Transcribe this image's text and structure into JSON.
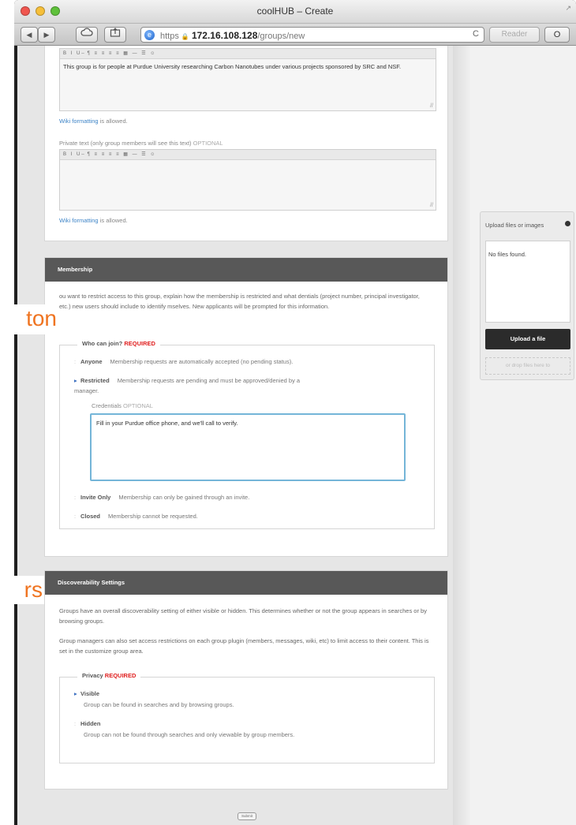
{
  "window": {
    "title": "coolHUB – Create",
    "back_glyph": "◀",
    "forward_glyph": "▶",
    "url_scheme": "https",
    "url_lock": "🔒",
    "url_host": "172.16.108.128",
    "url_path": "/groups/new",
    "reload_glyph": "C",
    "reader_label": "Reader",
    "reading_list_glyph": "O",
    "resize_glyph": "↗"
  },
  "description": {
    "toolbar_glyphs": "B I U ̶ ¶ ≡ ≡ ≡ ≡ ▦ — ☰ ☺",
    "public_text": "This group is for people at Purdue University researching Carbon Nanotubes under various projects sponsored by SRC and NSF.",
    "wiki_link": "Wiki formatting",
    "wiki_suffix": "is allowed.",
    "private_label": "Private text (only group members will see this text)",
    "private_optional": "OPTIONAL",
    "private_text": ""
  },
  "membership": {
    "header": "Membership",
    "intro": "ou want to restrict access to this group, explain how the membership is restricted and what dentials (project number, principal investigator, etc.) new users should include to identify mselves. New applicants will be prompted for this information.",
    "legend": "Who can join?",
    "required": "REQUIRED",
    "options": [
      {
        "name": "Anyone",
        "desc": "Membership requests are automatically accepted (no pending status).",
        "selected": false
      },
      {
        "name": "Restricted",
        "desc": "Membership requests are pending and must be approved/denied by a",
        "selected": true
      },
      {
        "name": "Invite Only",
        "desc": "Membership can only be gained through an invite.",
        "selected": false
      },
      {
        "name": "Closed",
        "desc": "Membership cannot be requested.",
        "selected": false
      }
    ],
    "restricted_cont": "manager.",
    "credentials_label": "Credentials",
    "credentials_optional": "OPTIONAL",
    "credentials_value": "Fill in your Purdue office phone, and we'll call to verify."
  },
  "discoverability": {
    "header": "Discoverability Settings",
    "para1": "Groups have an overall discoverability setting of either visible or hidden. This determines whether or not the group appears in searches or by browsing groups.",
    "para2": "Group managers can also set access restrictions on each group plugin (members, messages, wiki, etc) to limit access to their content. This is set in the customize group area.",
    "legend": "Privacy",
    "required": "REQUIRED",
    "options": [
      {
        "name": "Visible",
        "desc": "Group can be found in searches and by browsing groups.",
        "selected": true
      },
      {
        "name": "Hidden",
        "desc": "Group can not be found through searches and only viewable by group members.",
        "selected": false
      }
    ]
  },
  "sidebar": {
    "upload_title": "Upload files or images",
    "no_files": "No files found.",
    "upload_button": "Upload a file",
    "drop_text": "or drop files here to"
  },
  "submit_label": "Submit",
  "callouts": {
    "top": "ton",
    "bottom": "rs"
  },
  "colors": {
    "accent_orange": "#ef7421",
    "header_gray": "#585858",
    "required_red": "#e02020",
    "link_blue": "#3e84c7",
    "focus_blue": "#74b5d8"
  }
}
